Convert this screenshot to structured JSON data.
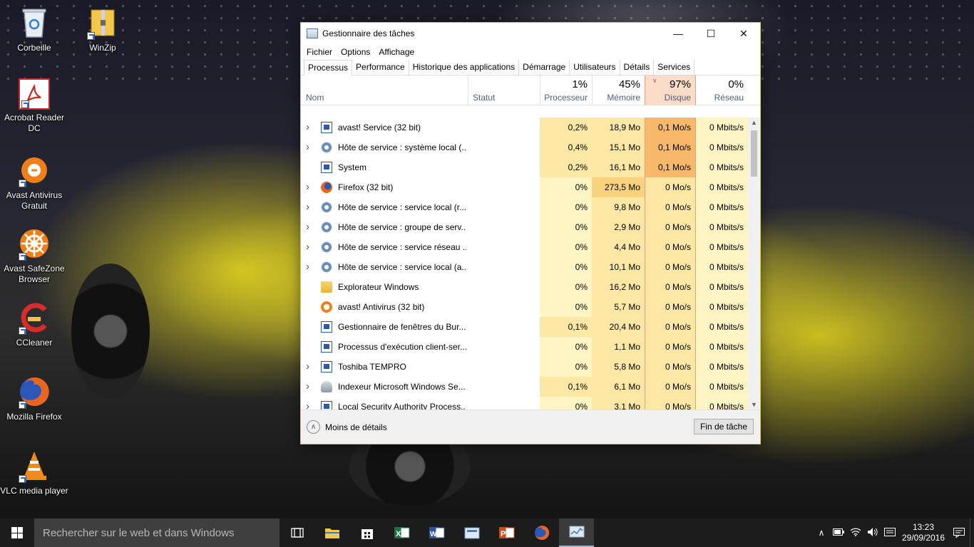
{
  "desktop": {
    "icons": [
      {
        "label": "Corbeille",
        "icon": "recycle-bin-icon"
      },
      {
        "label": "WinZip",
        "icon": "winzip-icon"
      },
      {
        "label": "Acrobat Reader DC",
        "icon": "acrobat-icon"
      },
      {
        "label": "Avast Antivirus Gratuit",
        "icon": "avast-icon"
      },
      {
        "label": "Avast SafeZone Browser",
        "icon": "safezone-icon"
      },
      {
        "label": "CCleaner",
        "icon": "ccleaner-icon"
      },
      {
        "label": "Mozilla Firefox",
        "icon": "firefox-icon"
      },
      {
        "label": "VLC media player",
        "icon": "vlc-icon"
      }
    ]
  },
  "window": {
    "title": "Gestionnaire des tâches",
    "controls": {
      "minimize": "—",
      "maximize": "☐",
      "close": "✕"
    },
    "menu": [
      "Fichier",
      "Options",
      "Affichage"
    ],
    "tabs": [
      "Processus",
      "Performance",
      "Historique des applications",
      "Démarrage",
      "Utilisateurs",
      "Détails",
      "Services"
    ],
    "active_tab": "Processus",
    "columns": {
      "name": "Nom",
      "status": "Statut",
      "cpu": {
        "label": "Processeur",
        "pct": "1%"
      },
      "memory": {
        "label": "Mémoire",
        "pct": "45%"
      },
      "disk": {
        "label": "Disque",
        "pct": "97%"
      },
      "network": {
        "label": "Réseau",
        "pct": "0%"
      }
    },
    "processes": [
      {
        "expand": true,
        "icon": "app-window-icon",
        "name": "avast! Service (32 bit)",
        "cpu": "0,2%",
        "mem": "18,9 Mo",
        "disk": "0,1 Mo/s",
        "net": "0 Mbits/s"
      },
      {
        "expand": true,
        "icon": "service-gear-icon",
        "name": "Hôte de service : système local (...",
        "cpu": "0,4%",
        "mem": "15,1 Mo",
        "disk": "0,1 Mo/s",
        "net": "0 Mbits/s"
      },
      {
        "expand": false,
        "icon": "app-window-icon",
        "name": "System",
        "cpu": "0,2%",
        "mem": "16,1 Mo",
        "disk": "0,1 Mo/s",
        "net": "0 Mbits/s"
      },
      {
        "expand": true,
        "icon": "firefox-icon",
        "name": "Firefox (32 bit)",
        "cpu": "0%",
        "mem": "273,5 Mo",
        "disk": "0 Mo/s",
        "net": "0 Mbits/s"
      },
      {
        "expand": true,
        "icon": "service-gear-icon",
        "name": "Hôte de service : service local (r...",
        "cpu": "0%",
        "mem": "9,8 Mo",
        "disk": "0 Mo/s",
        "net": "0 Mbits/s"
      },
      {
        "expand": true,
        "icon": "service-gear-icon",
        "name": "Hôte de service : groupe de serv...",
        "cpu": "0%",
        "mem": "2,9 Mo",
        "disk": "0 Mo/s",
        "net": "0 Mbits/s"
      },
      {
        "expand": true,
        "icon": "service-gear-icon",
        "name": "Hôte de service : service réseau ...",
        "cpu": "0%",
        "mem": "4,4 Mo",
        "disk": "0 Mo/s",
        "net": "0 Mbits/s"
      },
      {
        "expand": true,
        "icon": "service-gear-icon",
        "name": "Hôte de service : service local (a...",
        "cpu": "0%",
        "mem": "10,1 Mo",
        "disk": "0 Mo/s",
        "net": "0 Mbits/s"
      },
      {
        "expand": false,
        "icon": "folder-icon",
        "name": "Explorateur Windows",
        "cpu": "0%",
        "mem": "16,2 Mo",
        "disk": "0 Mo/s",
        "net": "0 Mbits/s"
      },
      {
        "expand": false,
        "icon": "avast-icon",
        "name": "avast! Antivirus (32 bit)",
        "cpu": "0%",
        "mem": "5,7 Mo",
        "disk": "0 Mo/s",
        "net": "0 Mbits/s"
      },
      {
        "expand": false,
        "icon": "app-window-icon",
        "name": "Gestionnaire de fenêtres du Bur...",
        "cpu": "0,1%",
        "mem": "20,4 Mo",
        "disk": "0 Mo/s",
        "net": "0 Mbits/s"
      },
      {
        "expand": false,
        "icon": "app-window-icon",
        "name": "Processus d'exécution client-ser...",
        "cpu": "0%",
        "mem": "1,1 Mo",
        "disk": "0 Mo/s",
        "net": "0 Mbits/s"
      },
      {
        "expand": true,
        "icon": "app-window-icon",
        "name": "Toshiba TEMPRO",
        "cpu": "0%",
        "mem": "5,8 Mo",
        "disk": "0 Mo/s",
        "net": "0 Mbits/s"
      },
      {
        "expand": true,
        "icon": "user-icon",
        "name": "Indexeur Microsoft Windows Se...",
        "cpu": "0,1%",
        "mem": "6,1 Mo",
        "disk": "0 Mo/s",
        "net": "0 Mbits/s"
      },
      {
        "expand": true,
        "icon": "app-window-icon",
        "name": "Local Security Authority Process...",
        "cpu": "0%",
        "mem": "3,1 Mo",
        "disk": "0 Mo/s",
        "net": "0 Mbits/s"
      }
    ],
    "footer": {
      "less_details": "Moins de détails",
      "end_task": "Fin de tâche"
    }
  },
  "taskbar": {
    "search_placeholder": "Rechercher sur le web et dans Windows",
    "pinned": [
      "task-view-icon",
      "file-explorer-icon",
      "store-icon",
      "excel-icon",
      "word-icon",
      "calculator-icon",
      "powerpoint-icon",
      "firefox-icon",
      "task-manager-icon"
    ],
    "clock": {
      "time": "13:23",
      "date": "29/09/2016"
    }
  },
  "colors": {
    "heat_light": "#fff4c4",
    "heat_medium": "#fde7a4",
    "heat_high": "#f9d27e",
    "heat_hot": "#f7b86a",
    "taskbar": "#1c1c1c",
    "accent": "#2c5aa0"
  }
}
